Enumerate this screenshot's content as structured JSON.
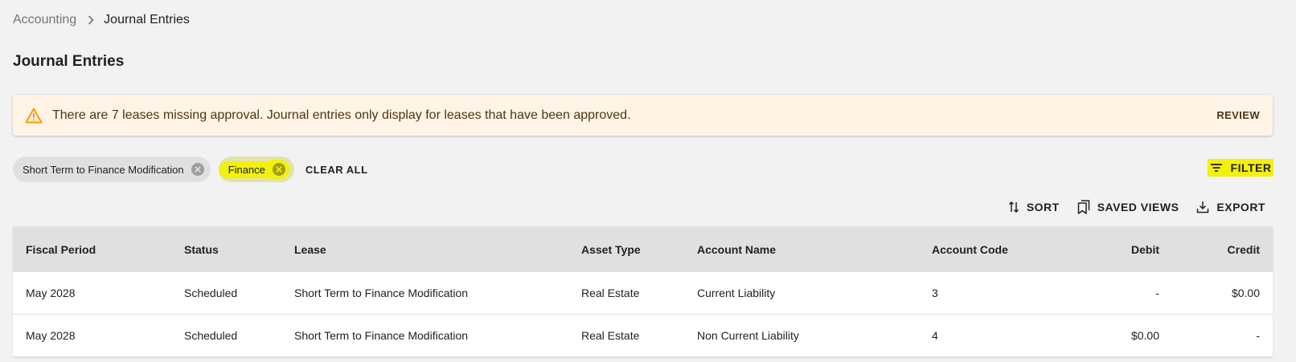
{
  "breadcrumb": {
    "root": "Accounting",
    "current": "Journal Entries"
  },
  "page_title": "Journal Entries",
  "alert": {
    "text": "There are 7 leases missing approval. Journal entries only display for leases that have been approved.",
    "action": "REVIEW",
    "icon": "warning-icon",
    "accent": "#ff9800"
  },
  "chips": [
    {
      "label": "Short Term to Finance Modification"
    },
    {
      "label": "Finance"
    }
  ],
  "clear_all": "CLEAR ALL",
  "filter_label": "FILTER",
  "toolbar": {
    "sort": "SORT",
    "saved_views": "SAVED VIEWS",
    "export": "EXPORT"
  },
  "highlight_color": "#f3f00e",
  "table": {
    "headers": {
      "fiscal_period": "Fiscal Period",
      "status": "Status",
      "lease": "Lease",
      "asset_type": "Asset Type",
      "account_name": "Account Name",
      "account_code": "Account Code",
      "debit": "Debit",
      "credit": "Credit"
    },
    "rows": [
      {
        "fiscal_period": "May 2028",
        "status": "Scheduled",
        "lease": "Short Term to Finance Modification",
        "asset_type": "Real Estate",
        "account_name": "Current Liability",
        "account_code": "3",
        "debit": "-",
        "credit": "$0.00"
      },
      {
        "fiscal_period": "May 2028",
        "status": "Scheduled",
        "lease": "Short Term to Finance Modification",
        "asset_type": "Real Estate",
        "account_name": "Non Current Liability",
        "account_code": "4",
        "debit": "$0.00",
        "credit": "-"
      }
    ]
  }
}
